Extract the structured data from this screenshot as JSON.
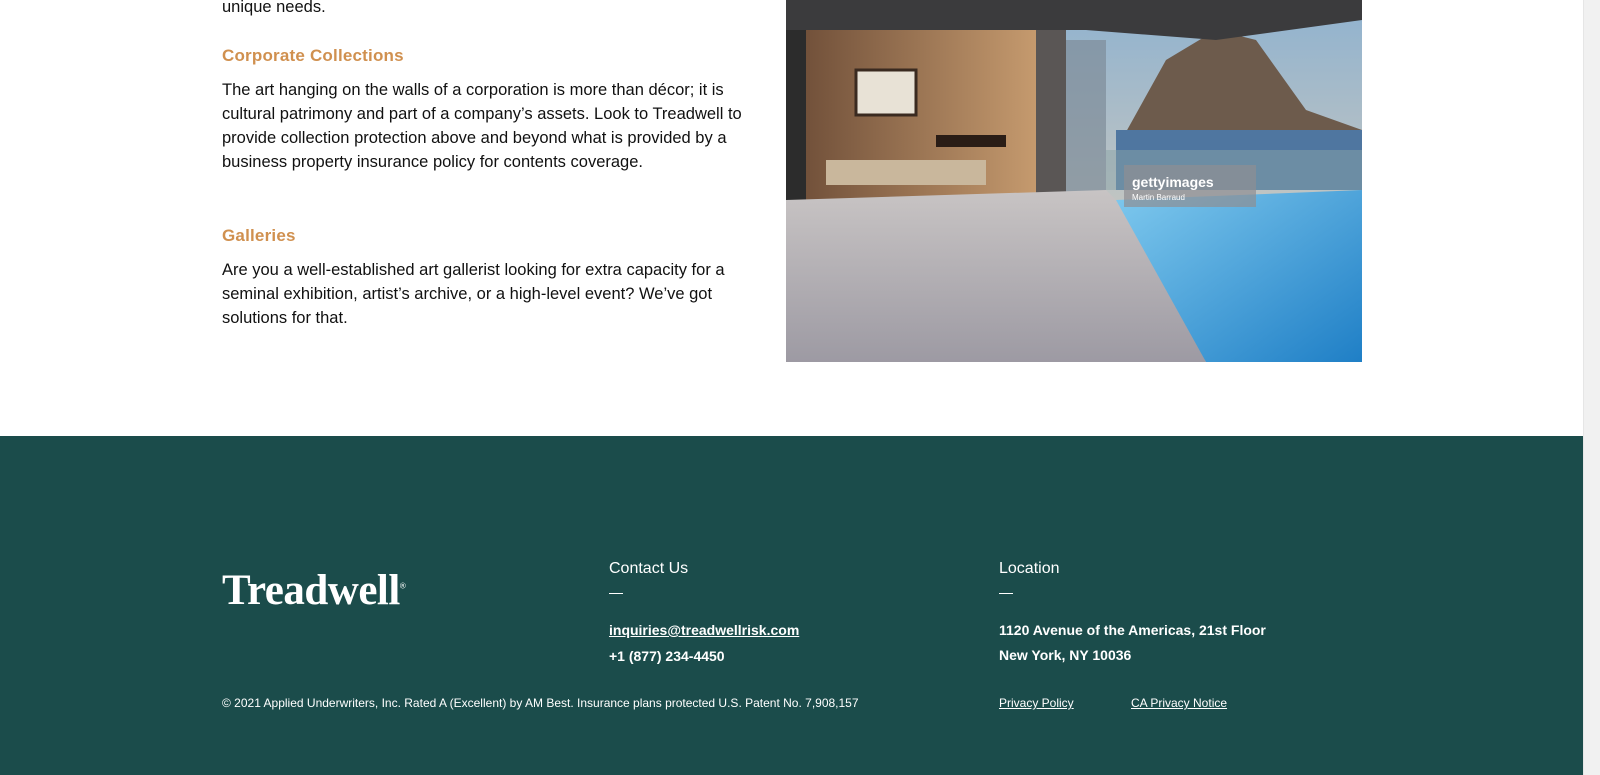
{
  "content": {
    "intro_tail": "unique needs.",
    "sections": [
      {
        "heading": "Corporate Collections",
        "body": "The art hanging on the walls of a corporation is more than décor; it is cultural patrimony and part of a company’s assets. Look to Treadwell to provide collection protection above and beyond what is provided by a business property insurance policy for contents coverage."
      },
      {
        "heading": "Galleries",
        "body": "Are you a well-established art gallerist looking for extra capacity for a seminal exhibition, artist’s archive, or a high-level event? We’ve got solutions for that."
      }
    ],
    "photo": {
      "watermark_brand": "gettyimages",
      "watermark_credit": "Martin Barraud"
    }
  },
  "footer": {
    "logo_text": "Treadwell",
    "logo_mark": "®",
    "contact": {
      "title": "Contact Us",
      "email": "inquiries@treadwellrisk.com",
      "phone": "+1 (877) 234-4450"
    },
    "location": {
      "title": "Location",
      "line1": "1120 Avenue of the Americas, 21st Floor",
      "line2": "New York, NY 10036"
    },
    "copyright": "© 2021 Applied Underwriters, Inc. Rated A (Excellent) by AM Best. Insurance plans protected U.S. Patent No. 7,908,157",
    "privacy_policy": "Privacy Policy",
    "ca_privacy_notice": "CA Privacy Notice"
  },
  "colors": {
    "accent": "#d0904f",
    "footer_bg": "#1b4c4b",
    "text": "#111111"
  }
}
